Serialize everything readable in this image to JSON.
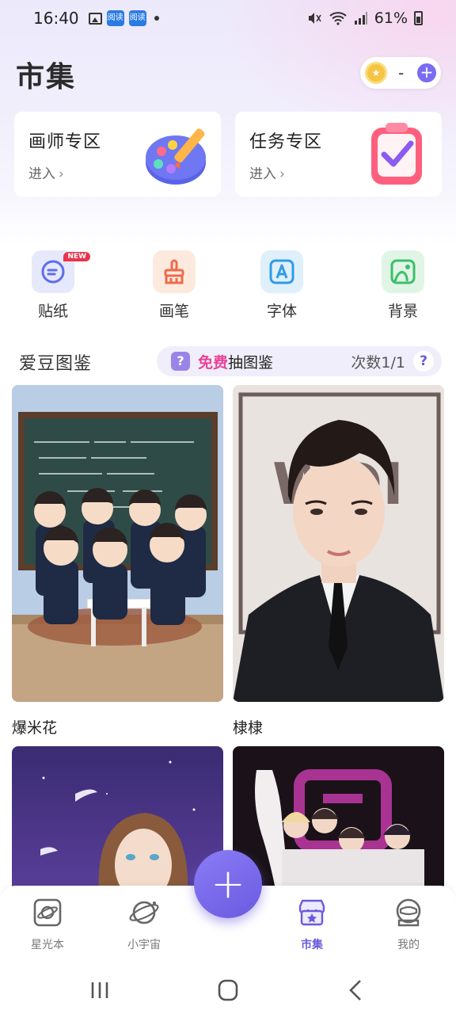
{
  "status_bar": {
    "time": "16:40",
    "app_badge": "阅读",
    "battery": "61%"
  },
  "header": {
    "title": "市集",
    "coin_value": "-"
  },
  "zones": [
    {
      "title": "画师专区",
      "enter": "进入"
    },
    {
      "title": "任务专区",
      "enter": "进入"
    }
  ],
  "categories": [
    {
      "label": "贴纸",
      "badge": "NEW"
    },
    {
      "label": "画笔"
    },
    {
      "label": "字体"
    },
    {
      "label": "背景"
    }
  ],
  "section": {
    "title": "爱豆图鉴",
    "free": "免费",
    "draw": "抽图鉴",
    "count": "次数1/1",
    "help": "?"
  },
  "gallery": [
    {
      "name": "爆米花"
    },
    {
      "name": "棣棣",
      "poster_text": "WDI"
    }
  ],
  "bottom_nav": [
    {
      "label": "星光本"
    },
    {
      "label": "小宇宙"
    },
    {
      "label": "市集",
      "active": true
    },
    {
      "label": "我的"
    }
  ],
  "colors": {
    "accent": "#6a5bd9",
    "free": "#e8449a",
    "badge": "#e8354d"
  }
}
